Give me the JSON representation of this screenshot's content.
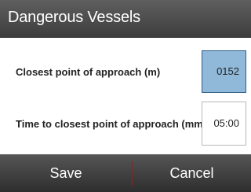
{
  "dialog": {
    "title": "Dangerous Vessels"
  },
  "fields": {
    "cpa": {
      "label": "Closest point of approach (m)",
      "value": "0152",
      "selected": true
    },
    "tcpa": {
      "label": "Time to closest point of approach (mm:ss)",
      "value": "05:00",
      "selected": false
    }
  },
  "buttons": {
    "save_label": "Save",
    "cancel_label": "Cancel"
  },
  "colors": {
    "title_bar": "#4a4a4a",
    "selected_field": "#8fb8d9",
    "button_bar": "#3a3a3a"
  }
}
